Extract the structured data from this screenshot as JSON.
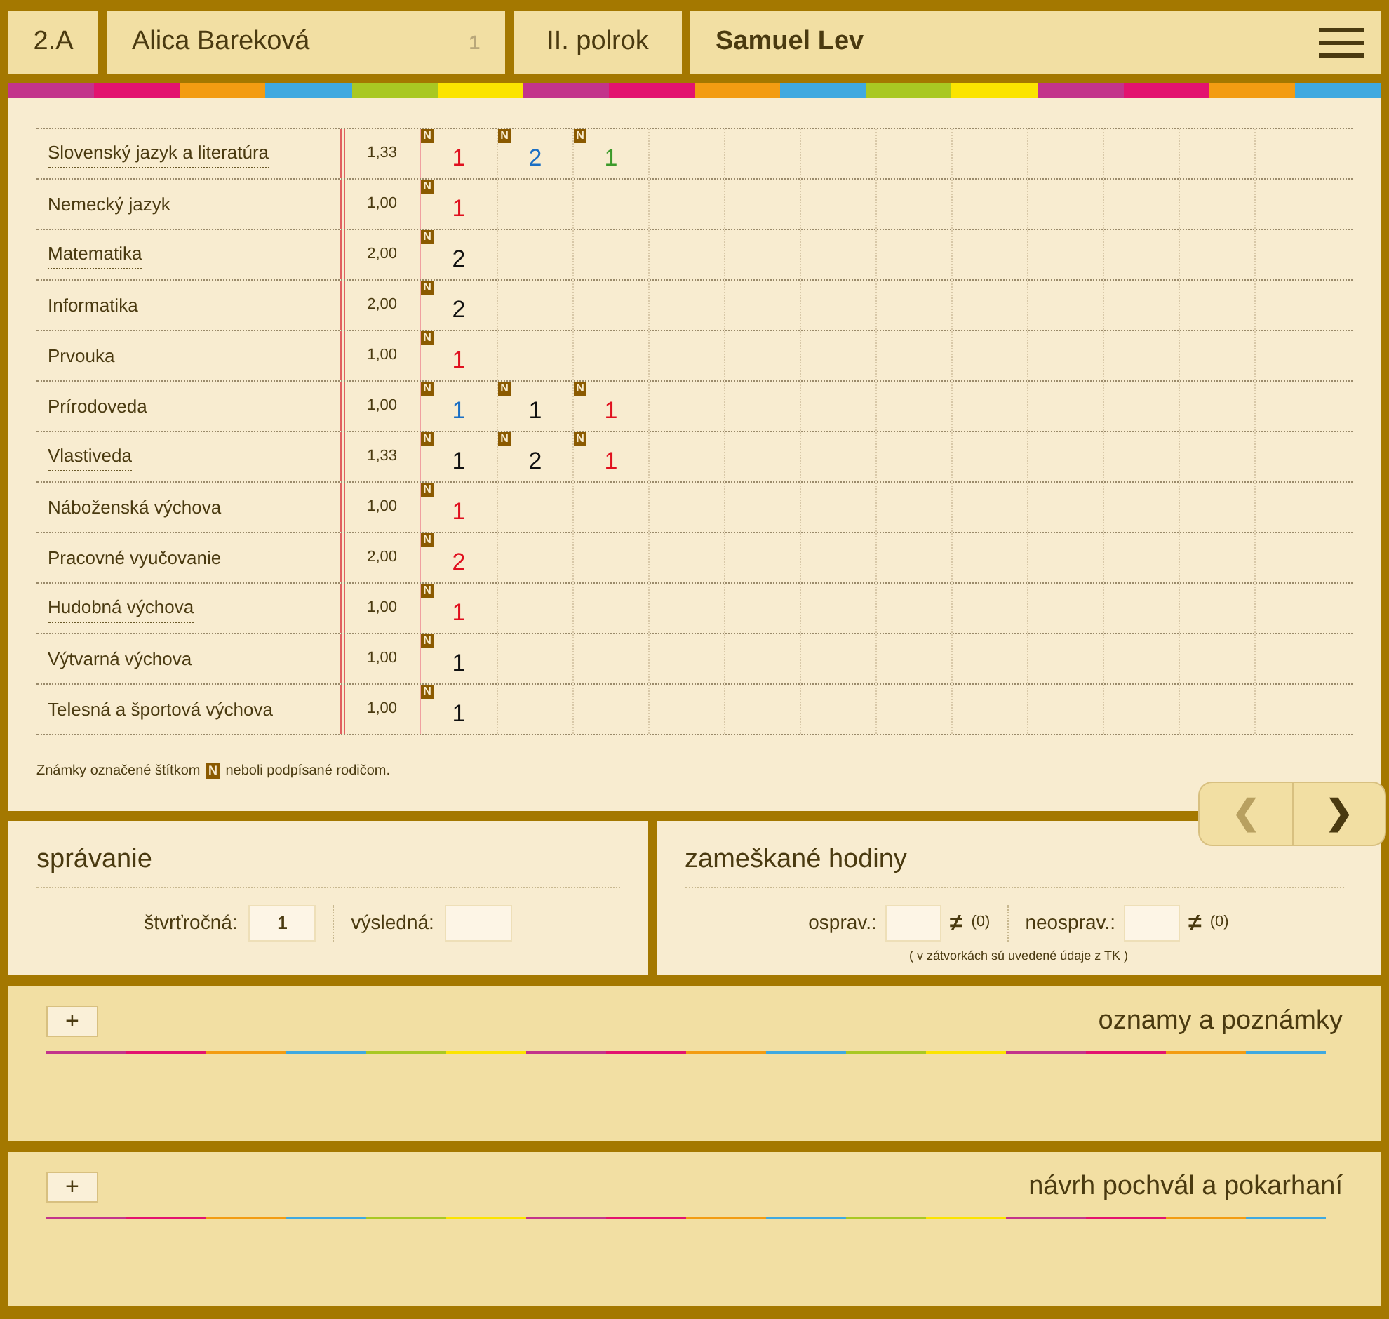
{
  "header": {
    "class": "2.A",
    "teacher": "Alica Bareková",
    "teacher_count": "1",
    "term": "II. polrok",
    "student": "Samuel Lev"
  },
  "grades": {
    "rows": [
      {
        "subject": "Slovenský jazyk a literatúra",
        "underlined": true,
        "average": "1,33",
        "marks": [
          {
            "value": "1",
            "color": "#e0101e",
            "tag": "N"
          },
          {
            "value": "2",
            "color": "#1b6fc4",
            "tag": "N"
          },
          {
            "value": "1",
            "color": "#3c9a2a",
            "tag": "N"
          }
        ]
      },
      {
        "subject": "Nemecký jazyk",
        "underlined": false,
        "average": "1,00",
        "marks": [
          {
            "value": "1",
            "color": "#e0101e",
            "tag": "N"
          }
        ]
      },
      {
        "subject": "Matematika",
        "underlined": true,
        "average": "2,00",
        "marks": [
          {
            "value": "2",
            "color": "#111111",
            "tag": "N"
          }
        ]
      },
      {
        "subject": "Informatika",
        "underlined": false,
        "average": "2,00",
        "marks": [
          {
            "value": "2",
            "color": "#111111",
            "tag": "N"
          }
        ]
      },
      {
        "subject": "Prvouka",
        "underlined": false,
        "average": "1,00",
        "marks": [
          {
            "value": "1",
            "color": "#e0101e",
            "tag": "N"
          }
        ]
      },
      {
        "subject": "Prírodoveda",
        "underlined": false,
        "average": "1,00",
        "marks": [
          {
            "value": "1",
            "color": "#1b6fc4",
            "tag": "N"
          },
          {
            "value": "1",
            "color": "#111111",
            "tag": "N"
          },
          {
            "value": "1",
            "color": "#e0101e",
            "tag": "N"
          }
        ]
      },
      {
        "subject": "Vlastiveda",
        "underlined": true,
        "average": "1,33",
        "marks": [
          {
            "value": "1",
            "color": "#111111",
            "tag": "N"
          },
          {
            "value": "2",
            "color": "#111111",
            "tag": "N"
          },
          {
            "value": "1",
            "color": "#e0101e",
            "tag": "N"
          }
        ]
      },
      {
        "subject": "Náboženská výchova",
        "underlined": false,
        "average": "1,00",
        "marks": [
          {
            "value": "1",
            "color": "#e0101e",
            "tag": "N"
          }
        ]
      },
      {
        "subject": "Pracovné vyučovanie",
        "underlined": false,
        "average": "2,00",
        "marks": [
          {
            "value": "2",
            "color": "#e0101e",
            "tag": "N"
          }
        ]
      },
      {
        "subject": "Hudobná výchova",
        "underlined": true,
        "average": "1,00",
        "marks": [
          {
            "value": "1",
            "color": "#e0101e",
            "tag": "N"
          }
        ]
      },
      {
        "subject": "Výtvarná výchova",
        "underlined": false,
        "average": "1,00",
        "marks": [
          {
            "value": "1",
            "color": "#111111",
            "tag": "N"
          }
        ]
      },
      {
        "subject": "Telesná a športová výchova",
        "underlined": false,
        "average": "1,00",
        "marks": [
          {
            "value": "1",
            "color": "#111111",
            "tag": "N"
          }
        ]
      }
    ],
    "note_before": "Známky označené štítkom",
    "note_tag": "N",
    "note_after": "neboli podpísané rodičom."
  },
  "pager": {
    "prev": {
      "symbol": "❮",
      "disabled": true
    },
    "next": {
      "symbol": "❯",
      "disabled": false
    }
  },
  "behavior": {
    "title": "správanie",
    "fields": [
      {
        "label": "štvrťročná:",
        "value": "1"
      },
      {
        "label": "výsledná:"
      }
    ]
  },
  "absences": {
    "title": "zameškané hodiny",
    "fields": [
      {
        "label": "osprav.:",
        "sign": "≠",
        "tk": "(0)"
      },
      {
        "label": "neosprav.:",
        "sign": "≠",
        "tk": "(0)"
      }
    ],
    "note": "( v zátvorkách sú uvedené údaje z TK )"
  },
  "sections": [
    {
      "add": "+",
      "title": "oznamy a poznámky"
    },
    {
      "add": "+",
      "title": "návrh pochvál a pokarhaní"
    }
  ]
}
